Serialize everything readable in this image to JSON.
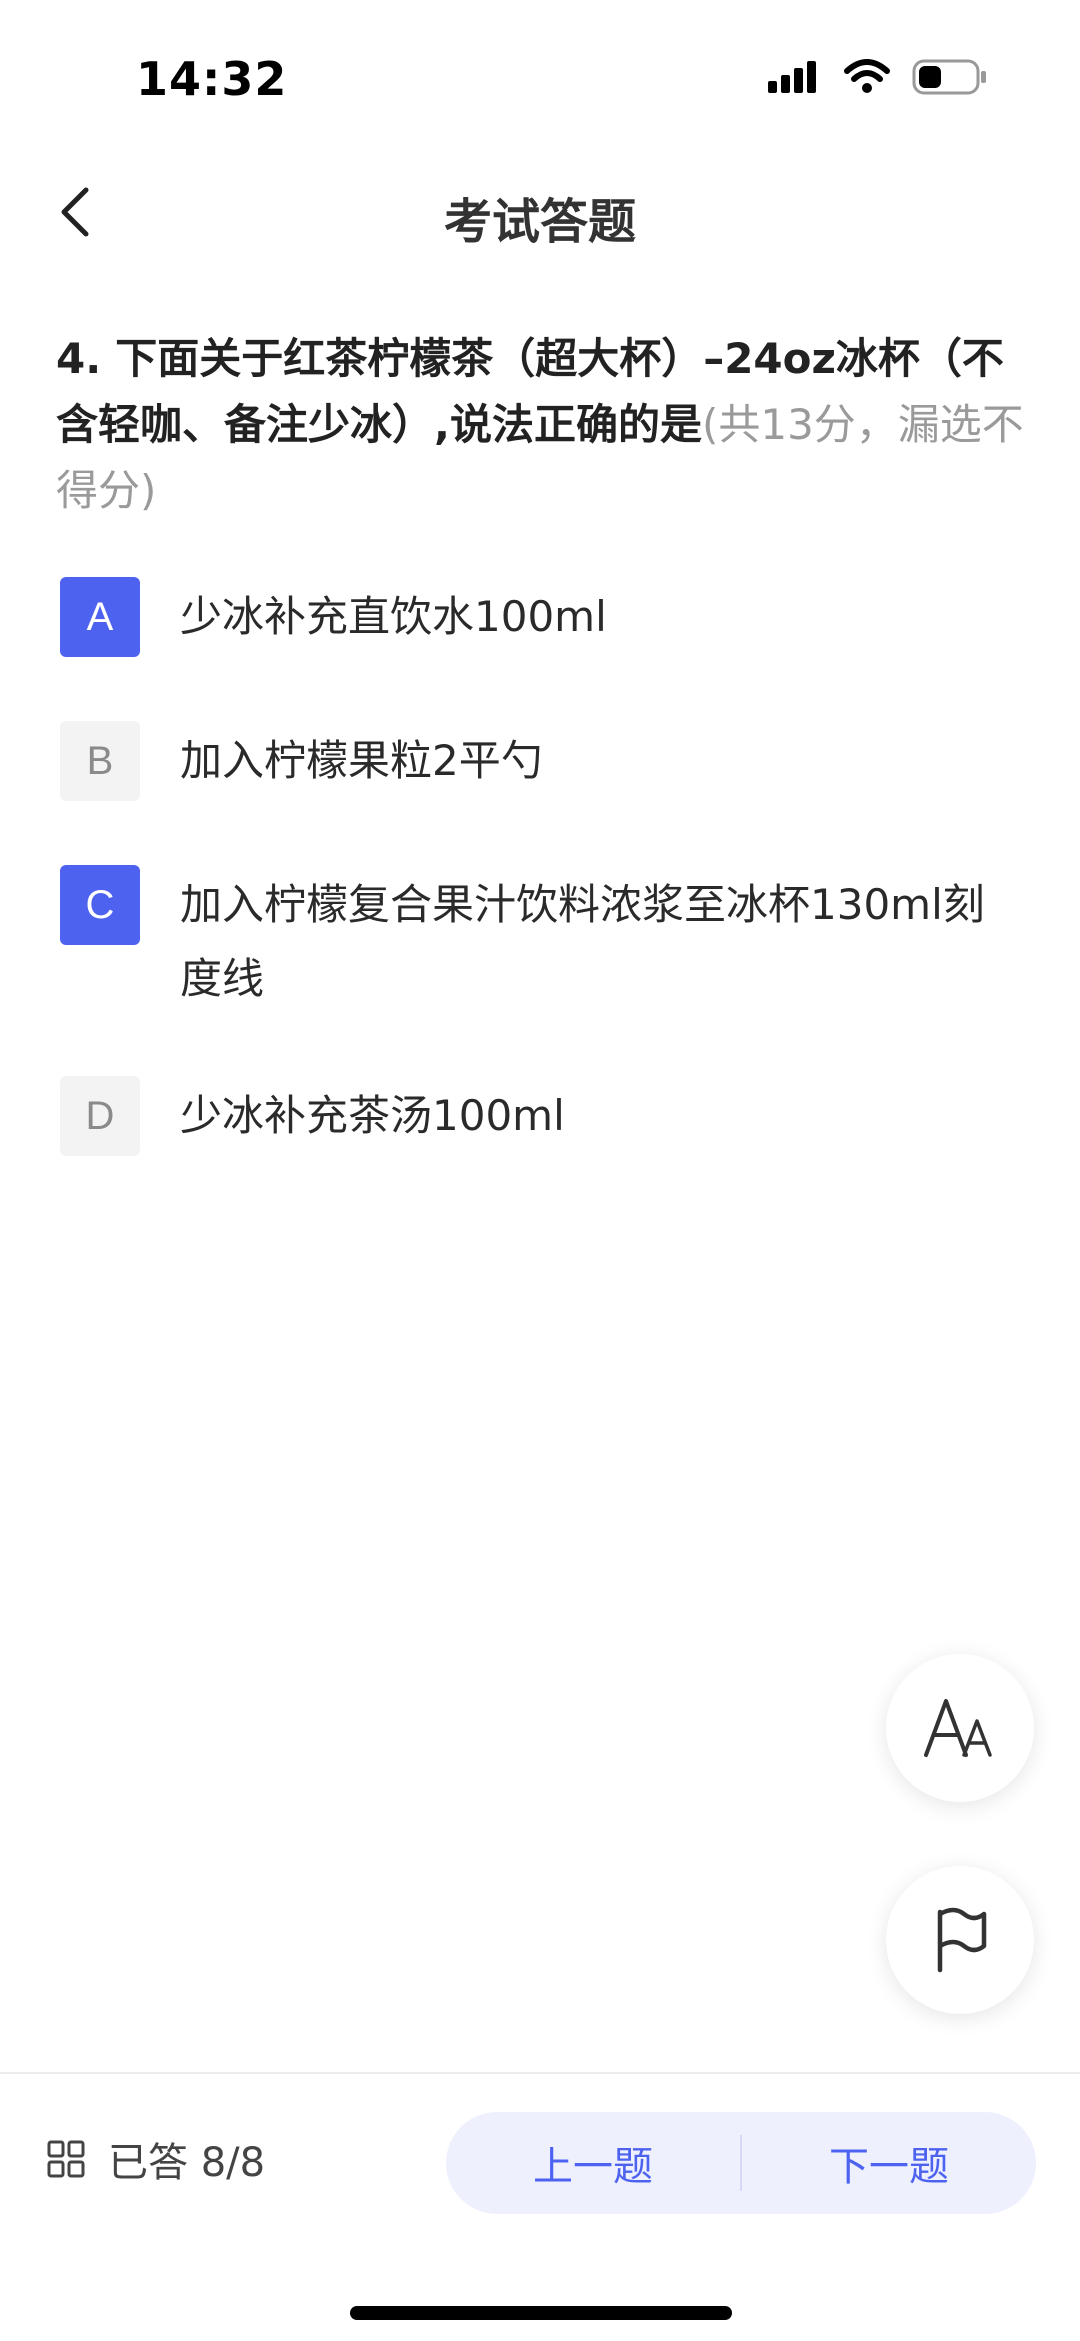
{
  "status_bar": {
    "time": "14:32"
  },
  "header": {
    "title": "考试答题"
  },
  "question": {
    "number": "4.",
    "text": "下面关于红茶柠檬茶（超大杯）–24oz冰杯（不含轻咖、备注少冰）,说法正确的是",
    "score_note": "(共13分，漏选不得分)"
  },
  "options": [
    {
      "letter": "A",
      "text": "少冰补充直饮水100ml",
      "selected": true
    },
    {
      "letter": "B",
      "text": "加入柠檬果粒2平勺",
      "selected": false
    },
    {
      "letter": "C",
      "text": "加入柠檬复合果汁饮料浓浆至冰杯130ml刻度线",
      "selected": true
    },
    {
      "letter": "D",
      "text": "少冰补充茶汤100ml",
      "selected": false
    }
  ],
  "fabs": {
    "font_size_icon": "font-size-icon",
    "flag_icon": "flag-icon"
  },
  "footer": {
    "answered_label": "已答 8/8",
    "prev_label": "上一题",
    "next_label": "下一题"
  },
  "colors": {
    "accent": "#4d63f0",
    "pill_bg": "#eef0fe",
    "unselected_bg": "#f3f3f3"
  }
}
